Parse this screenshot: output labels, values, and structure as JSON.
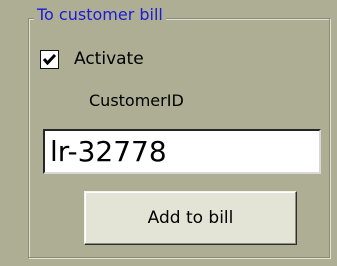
{
  "groupbox": {
    "title": "To customer bill",
    "activate_label": "Activate",
    "activate_checked": true,
    "customer_id_label": "CustomerID",
    "customer_id_value": "lr-32778",
    "add_button_label": "Add to bill"
  },
  "colors": {
    "background": "#aeae95",
    "legend_text": "#1a1ad8",
    "button_face": "#e3e3d6"
  },
  "icons": {
    "checkbox_mark": "check-icon"
  }
}
